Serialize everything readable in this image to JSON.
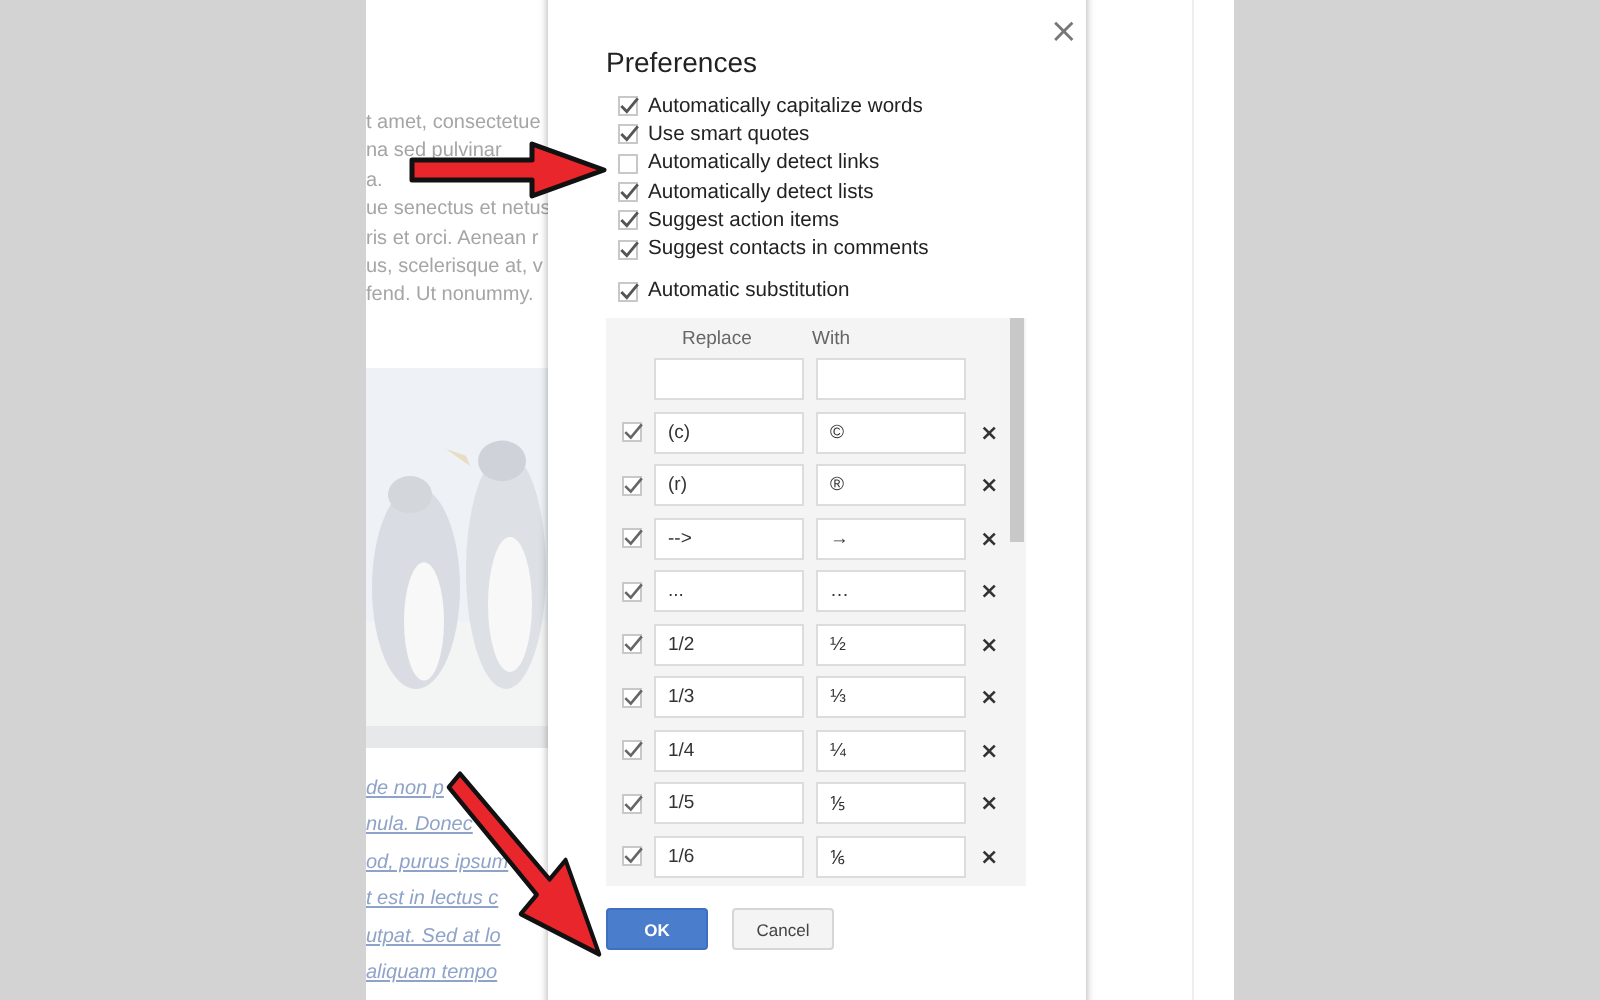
{
  "document": {
    "lines": [
      "t amet, consectetue",
      "na sed pulvinar",
      "a.",
      "ue senectus et netus",
      "ris et orci. Aenean r",
      "us, scelerisque at, v",
      "fend. Ut nonummy."
    ],
    "picture": {
      "kind": "picture"
    },
    "caption_lines": [
      "de non p",
      "nula. Donec",
      "od, purus ipsum",
      "t est in lectus c",
      "utpat. Sed at lo",
      "aliquam tempo"
    ]
  },
  "dialog": {
    "title": "Preferences",
    "close": "×",
    "options": [
      {
        "label": "Automatically capitalize words",
        "checked": true
      },
      {
        "label": "Use smart quotes",
        "checked": true
      },
      {
        "label": "Automatically detect links",
        "checked": false
      },
      {
        "label": "Automatically detect lists",
        "checked": true
      },
      {
        "label": "Suggest action items",
        "checked": true
      },
      {
        "label": "Suggest contacts in comments",
        "checked": true
      }
    ],
    "substitution": {
      "label": "Automatic substitution",
      "checked": true
    },
    "table": {
      "columns": [
        "Replace",
        "With"
      ],
      "rows": [
        {
          "checked": true,
          "replace": "(c)",
          "with": "©",
          "delete": "×"
        },
        {
          "checked": true,
          "replace": "(r)",
          "with": "®",
          "delete": "×"
        },
        {
          "checked": true,
          "replace": "-->",
          "with": "→",
          "delete": "×"
        },
        {
          "checked": true,
          "replace": "...",
          "with": "…",
          "delete": "×"
        },
        {
          "checked": true,
          "replace": "1/2",
          "with": "½",
          "delete": "×"
        },
        {
          "checked": true,
          "replace": "1/3",
          "with": "⅓",
          "delete": "×"
        },
        {
          "checked": true,
          "replace": "1/4",
          "with": "¼",
          "delete": "×"
        },
        {
          "checked": true,
          "replace": "1/5",
          "with": "⅕",
          "delete": "×"
        },
        {
          "checked": true,
          "replace": "1/6",
          "with": "⅙",
          "delete": "×"
        }
      ]
    },
    "buttons": [
      "OK",
      "Cancel"
    ]
  }
}
